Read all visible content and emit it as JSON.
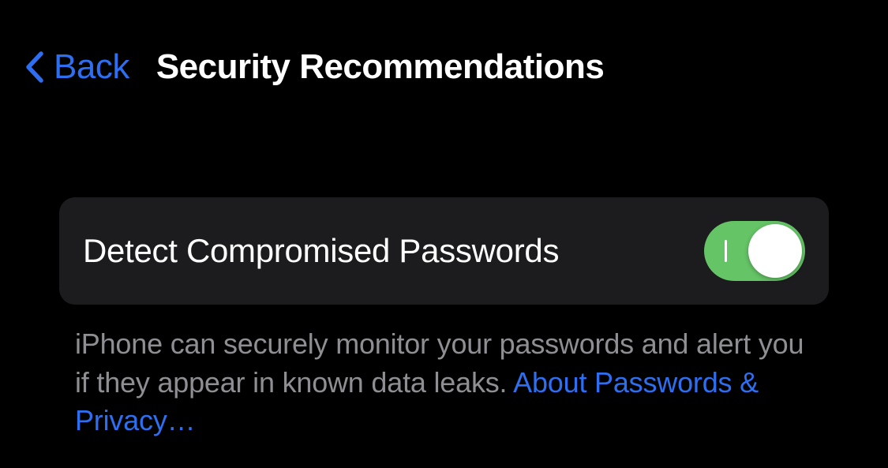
{
  "header": {
    "back_label": "Back",
    "title": "Security Recommendations"
  },
  "settings": {
    "detect_compromised": {
      "label": "Detect Compromised Passwords",
      "enabled": true
    }
  },
  "footer": {
    "description": "iPhone can securely monitor your passwords and alert you if they appear in known data leaks. ",
    "link_text": "About Passwords & Privacy…"
  },
  "colors": {
    "accent": "#2e6ff2",
    "toggle_on": "#65c466",
    "background": "#000000",
    "row_background": "#1c1c1e",
    "secondary_text": "#8e8e93"
  }
}
